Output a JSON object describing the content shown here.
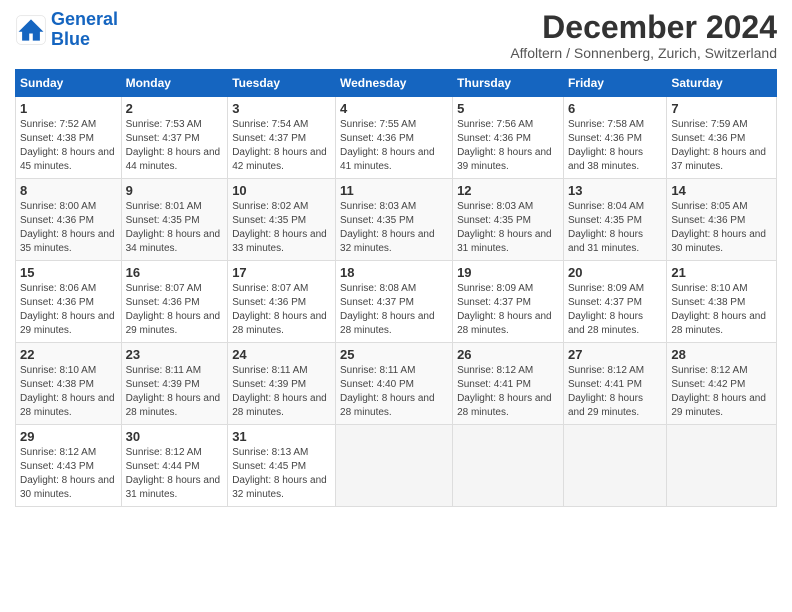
{
  "header": {
    "logo_line1": "General",
    "logo_line2": "Blue",
    "month": "December 2024",
    "location": "Affoltern / Sonnenberg, Zurich, Switzerland"
  },
  "days_of_week": [
    "Sunday",
    "Monday",
    "Tuesday",
    "Wednesday",
    "Thursday",
    "Friday",
    "Saturday"
  ],
  "weeks": [
    [
      {
        "day": "1",
        "sunrise": "7:52 AM",
        "sunset": "4:38 PM",
        "daylight": "8 hours and 45 minutes."
      },
      {
        "day": "2",
        "sunrise": "7:53 AM",
        "sunset": "4:37 PM",
        "daylight": "8 hours and 44 minutes."
      },
      {
        "day": "3",
        "sunrise": "7:54 AM",
        "sunset": "4:37 PM",
        "daylight": "8 hours and 42 minutes."
      },
      {
        "day": "4",
        "sunrise": "7:55 AM",
        "sunset": "4:36 PM",
        "daylight": "8 hours and 41 minutes."
      },
      {
        "day": "5",
        "sunrise": "7:56 AM",
        "sunset": "4:36 PM",
        "daylight": "8 hours and 39 minutes."
      },
      {
        "day": "6",
        "sunrise": "7:58 AM",
        "sunset": "4:36 PM",
        "daylight": "8 hours and 38 minutes."
      },
      {
        "day": "7",
        "sunrise": "7:59 AM",
        "sunset": "4:36 PM",
        "daylight": "8 hours and 37 minutes."
      }
    ],
    [
      {
        "day": "8",
        "sunrise": "8:00 AM",
        "sunset": "4:36 PM",
        "daylight": "8 hours and 35 minutes."
      },
      {
        "day": "9",
        "sunrise": "8:01 AM",
        "sunset": "4:35 PM",
        "daylight": "8 hours and 34 minutes."
      },
      {
        "day": "10",
        "sunrise": "8:02 AM",
        "sunset": "4:35 PM",
        "daylight": "8 hours and 33 minutes."
      },
      {
        "day": "11",
        "sunrise": "8:03 AM",
        "sunset": "4:35 PM",
        "daylight": "8 hours and 32 minutes."
      },
      {
        "day": "12",
        "sunrise": "8:03 AM",
        "sunset": "4:35 PM",
        "daylight": "8 hours and 31 minutes."
      },
      {
        "day": "13",
        "sunrise": "8:04 AM",
        "sunset": "4:35 PM",
        "daylight": "8 hours and 31 minutes."
      },
      {
        "day": "14",
        "sunrise": "8:05 AM",
        "sunset": "4:36 PM",
        "daylight": "8 hours and 30 minutes."
      }
    ],
    [
      {
        "day": "15",
        "sunrise": "8:06 AM",
        "sunset": "4:36 PM",
        "daylight": "8 hours and 29 minutes."
      },
      {
        "day": "16",
        "sunrise": "8:07 AM",
        "sunset": "4:36 PM",
        "daylight": "8 hours and 29 minutes."
      },
      {
        "day": "17",
        "sunrise": "8:07 AM",
        "sunset": "4:36 PM",
        "daylight": "8 hours and 28 minutes."
      },
      {
        "day": "18",
        "sunrise": "8:08 AM",
        "sunset": "4:37 PM",
        "daylight": "8 hours and 28 minutes."
      },
      {
        "day": "19",
        "sunrise": "8:09 AM",
        "sunset": "4:37 PM",
        "daylight": "8 hours and 28 minutes."
      },
      {
        "day": "20",
        "sunrise": "8:09 AM",
        "sunset": "4:37 PM",
        "daylight": "8 hours and 28 minutes."
      },
      {
        "day": "21",
        "sunrise": "8:10 AM",
        "sunset": "4:38 PM",
        "daylight": "8 hours and 28 minutes."
      }
    ],
    [
      {
        "day": "22",
        "sunrise": "8:10 AM",
        "sunset": "4:38 PM",
        "daylight": "8 hours and 28 minutes."
      },
      {
        "day": "23",
        "sunrise": "8:11 AM",
        "sunset": "4:39 PM",
        "daylight": "8 hours and 28 minutes."
      },
      {
        "day": "24",
        "sunrise": "8:11 AM",
        "sunset": "4:39 PM",
        "daylight": "8 hours and 28 minutes."
      },
      {
        "day": "25",
        "sunrise": "8:11 AM",
        "sunset": "4:40 PM",
        "daylight": "8 hours and 28 minutes."
      },
      {
        "day": "26",
        "sunrise": "8:12 AM",
        "sunset": "4:41 PM",
        "daylight": "8 hours and 28 minutes."
      },
      {
        "day": "27",
        "sunrise": "8:12 AM",
        "sunset": "4:41 PM",
        "daylight": "8 hours and 29 minutes."
      },
      {
        "day": "28",
        "sunrise": "8:12 AM",
        "sunset": "4:42 PM",
        "daylight": "8 hours and 29 minutes."
      }
    ],
    [
      {
        "day": "29",
        "sunrise": "8:12 AM",
        "sunset": "4:43 PM",
        "daylight": "8 hours and 30 minutes."
      },
      {
        "day": "30",
        "sunrise": "8:12 AM",
        "sunset": "4:44 PM",
        "daylight": "8 hours and 31 minutes."
      },
      {
        "day": "31",
        "sunrise": "8:13 AM",
        "sunset": "4:45 PM",
        "daylight": "8 hours and 32 minutes."
      },
      null,
      null,
      null,
      null
    ]
  ],
  "labels": {
    "sunrise": "Sunrise:",
    "sunset": "Sunset:",
    "daylight": "Daylight:"
  }
}
